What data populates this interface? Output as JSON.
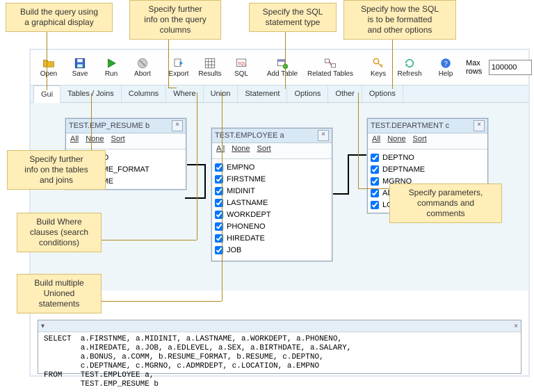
{
  "callouts": {
    "c1": "Build the query using\na graphical display",
    "c2": "Specify further\ninfo on the query\ncolumns",
    "c3": "Specify the SQL\nstatement type",
    "c4": "Specify how the SQL\nis to be formatted\nand other options",
    "c5": "Specify further\ninfo on the tables\nand joins",
    "c6": "Build Where\nclauses (search\nconditions)",
    "c7": "Build multiple\nUnioned\nstatements",
    "c8": "Specify parameters,\ncommands and\ncomments"
  },
  "toolbar": {
    "open": "Open",
    "save": "Save",
    "run": "Run",
    "abort": "Abort",
    "export": "Export",
    "results": "Results",
    "sql": "SQL",
    "addtable": "Add Table",
    "related": "Related Tables",
    "keys": "Keys",
    "refresh": "Refresh",
    "help": "Help",
    "maxrows_label": "Max rows",
    "maxrows_value": "100000"
  },
  "tabs": {
    "gui": "Gui",
    "tablesjoins": "Tables / Joins",
    "columns": "Columns",
    "where": "Where",
    "union": "Union",
    "statement": "Statement",
    "options": "Options",
    "other": "Other",
    "options2": "Options"
  },
  "subbar": {
    "all": "All",
    "none": "None",
    "sort": "Sort"
  },
  "tables": {
    "b": {
      "title": "TEST.EMP_RESUME b",
      "cols": [
        "EMPNO",
        "RESUME_FORMAT",
        "RESUME"
      ]
    },
    "a": {
      "title": "TEST.EMPLOYEE a",
      "cols": [
        "EMPNO",
        "FIRSTNME",
        "MIDINIT",
        "LASTNAME",
        "WORKDEPT",
        "PHONENO",
        "HIREDATE",
        "JOB"
      ]
    },
    "c": {
      "title": "TEST.DEPARTMENT c",
      "cols": [
        "DEPTNO",
        "DEPTNAME",
        "MGRNO",
        "ADMRDEPT",
        "LOCATION"
      ]
    }
  },
  "sql": {
    "text": "SELECT  a.FIRSTNME, a.MIDINIT, a.LASTNAME, a.WORKDEPT, a.PHONENO,\n        a.HIREDATE, a.JOB, a.EDLEVEL, a.SEX, a.BIRTHDATE, a.SALARY,\n        a.BONUS, a.COMM, b.RESUME_FORMAT, b.RESUME, c.DEPTNO,\n        c.DEPTNAME, c.MGRNO, c.ADMRDEPT, c.LOCATION, a.EMPNO\nFROM    TEST.EMPLOYEE a,\n        TEST.EMP_RESUME b"
  }
}
